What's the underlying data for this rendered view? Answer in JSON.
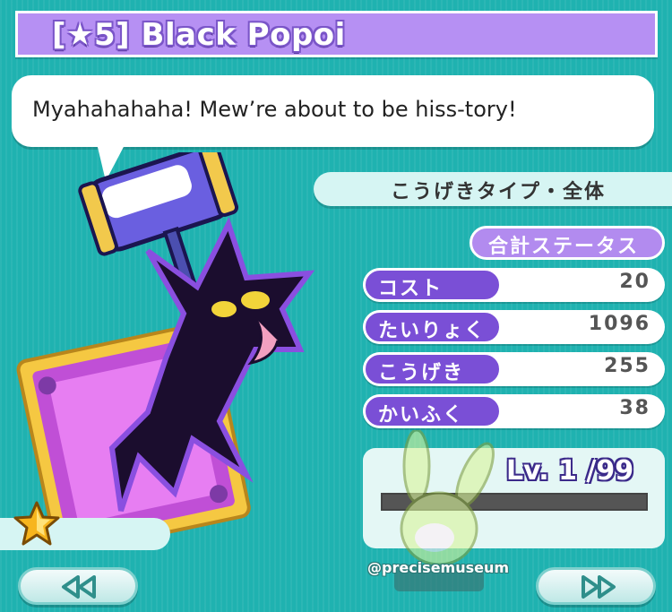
{
  "title": "[★5]  Black Popoi",
  "speech": "Myahahahaha! Mew’re about to be hiss-tory!",
  "type_label": "こうげきタイプ・全体",
  "total_status_label": "合計ステータス",
  "stats": [
    {
      "label": "コスト",
      "value": "20"
    },
    {
      "label": "たいりょく",
      "value": "1096"
    },
    {
      "label": "こうげき",
      "value": "255"
    },
    {
      "label": "かいふく",
      "value": "38"
    }
  ],
  "level": "Lv. 1 /99",
  "exp_fraction": 0.0,
  "watermark": "@precisemuseum",
  "colors": {
    "background": "#1fb2b0",
    "accent": "#7a4fd6",
    "title_bg": "#b690f3"
  },
  "icons": {
    "prev": "rewind-icon",
    "next": "fast-forward-icon",
    "rarity": "star-icon"
  }
}
